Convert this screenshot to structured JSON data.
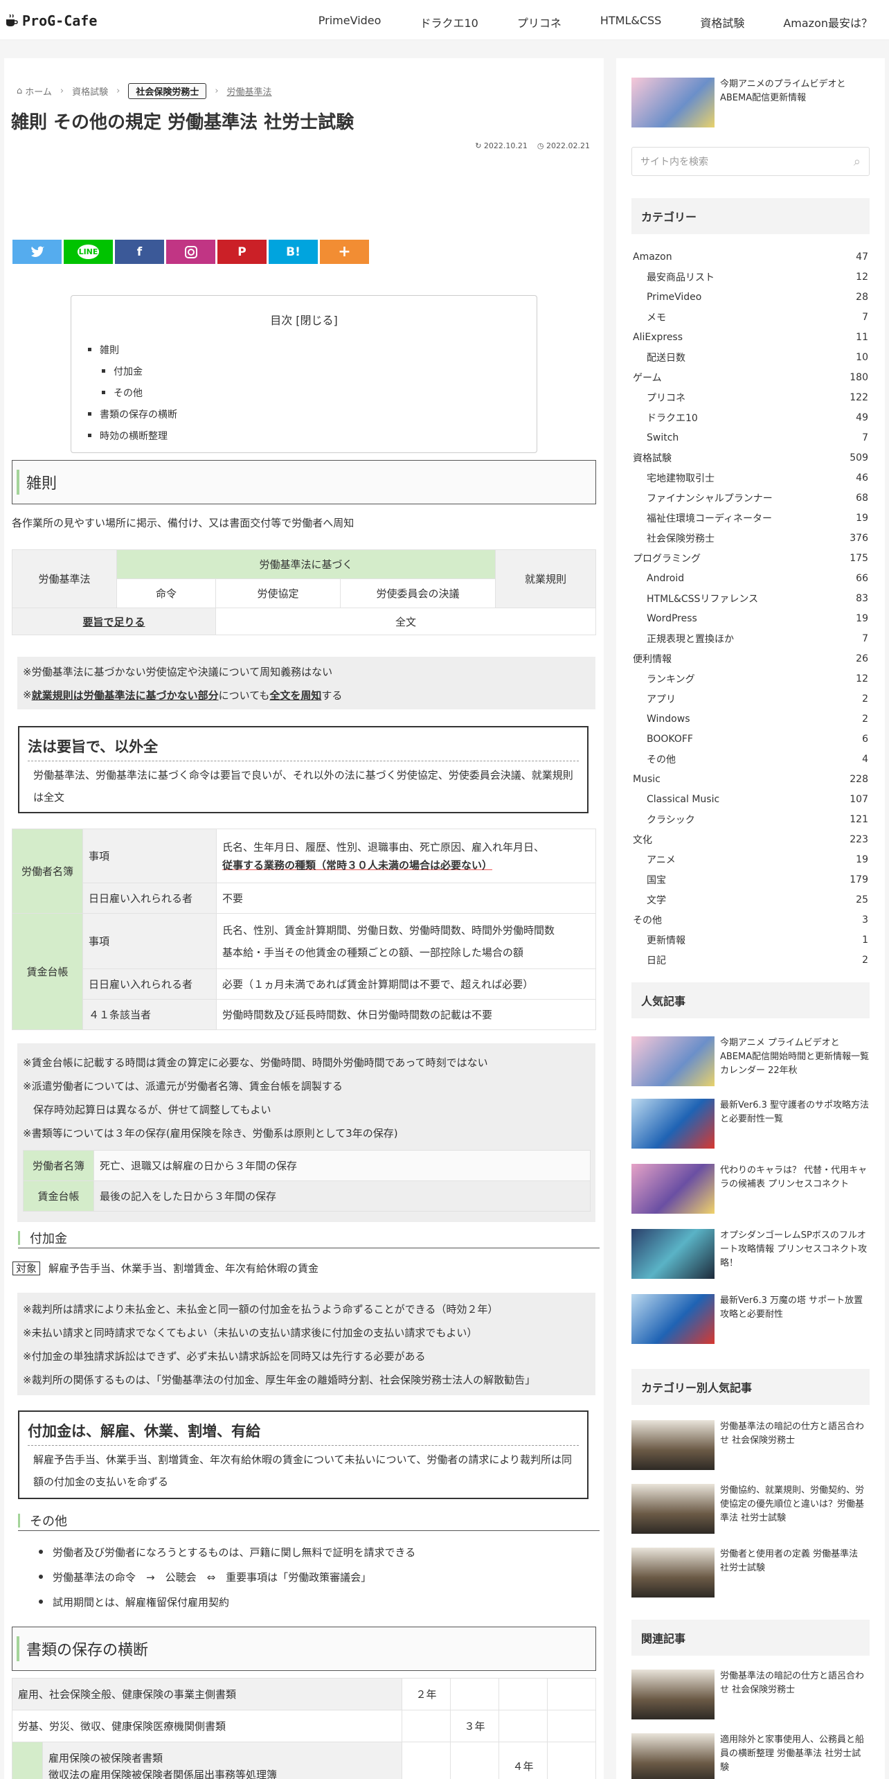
{
  "header": {
    "logo": "ProG-Cafe",
    "nav": [
      "PrimeVideo",
      "ドラクエ10",
      "プリコネ",
      "HTML&CSS",
      "資格試験",
      "Amazon最安は？"
    ]
  },
  "breadcrumb": {
    "home": "ホーム",
    "cat": "資格試験",
    "current": "社会保険労務士",
    "last": "労働基準法"
  },
  "article": {
    "title": "雑則 その他の規定 労働基準法 社労士試験",
    "updated": "2022.10.21",
    "published": "2022.02.21",
    "share": [
      "twitter",
      "LINE",
      "f",
      "instagram",
      "P",
      "B!",
      "+"
    ],
    "toc": {
      "title": "目次",
      "toggle": "[閉じる]",
      "items": [
        "雑則",
        "付加金",
        "その他",
        "書類の保存の横断",
        "時効の横断整理"
      ]
    },
    "s1": {
      "heading": "雑則",
      "intro": "各作業所の見やすい場所に掲示、備付け、又は書面交付等で労働者へ周知",
      "t1": {
        "row_head": "労働基準法",
        "based": "労働基準法に基づく",
        "employment": "就業規則",
        "c1": "命令",
        "c2": "労使協定",
        "c3": "労使委員会の決議",
        "summary": "要旨で足りる",
        "full": "全文"
      },
      "note1": [
        "※労働基準法に基づかない労使協定や決議について周知義務はない"
      ],
      "note1b": {
        "a": "※",
        "b": "就業規則は労働基準法に基づかない部分",
        "c": "についても",
        "d": "全文を周知",
        "e": "する"
      },
      "box1": {
        "title": "法は要旨で、以外全",
        "body": "労働基準法、労働基準法に基づく命令は要旨で良いが、それ以外の法に基づく労使協定、労使委員会決議、就業規則は全文"
      },
      "t2": {
        "roster": "労働者名簿",
        "wage": "賃金台帳",
        "item": "事項",
        "day": "日日雇い入れられる者",
        "art41": "４１条該当者",
        "roster_item_1": "氏名、生年月日、履歴、性別、退職事由、死亡原因、雇入れ年月日、",
        "roster_item_2": "従事する業務の種類（常時３０人未満の場合は必要ない）",
        "roster_day": "不要",
        "wage_item_1": "氏名、性別、賃金計算期間、労働日数、労働時間数、時間外労働時間数",
        "wage_item_2": "基本給・手当その他賃金の種類ごとの額、一部控除した場合の額",
        "wage_day": "必要（１ヵ月未満であれば賃金計算期間は不要で、超えれば必要）",
        "wage_41": "労働時間数及び延長時間数、休日労働時間数の記載は不要"
      },
      "note2": [
        "※賃金台帳に記載する時間は賃金の算定に必要な、労働時間、時間外労働時間であって時刻ではない",
        "※派遣労働者については、派遣元が労働者名簿、賃金台帳を調製する",
        "　保存時効起算日は異なるが、併せて調整してもよい",
        "※書類等については３年の保存(雇用保険を除き、労働系は原則として3年の保存)"
      ],
      "keep": [
        {
          "k": "労働者名簿",
          "v": "死亡、退職又は解雇の日から３年間の保存"
        },
        {
          "k": "賃金台帳",
          "v": "最後の記入をした日から３年間の保存"
        }
      ]
    },
    "s2": {
      "heading": "付加金",
      "target_label": "対象",
      "target": "解雇予告手当、休業手当、割増賃金、年次有給休暇の賃金",
      "note": [
        "※裁判所は請求により未払金と、未払金と同一額の付加金を払うよう命ずることができる（時効２年）",
        "※未払い請求と同時請求でなくてもよい（未払いの支払い請求後に付加金の支払い請求でもよい）",
        "※付加金の単独請求訴訟はできず、必ず未払い請求訴訟を同時又は先行する必要がある",
        "※裁判所の関係するものは、「労働基準法の付加金、厚生年金の離婚時分割、社会保険労務士法人の解散勧告」"
      ],
      "box": {
        "title": "付加金は、解雇、休業、割増、有給",
        "body": "解雇予告手当、休業手当、割増賃金、年次有給休暇の賃金について未払いについて、労働者の請求により裁判所は同額の付加金の支払いを命ずる"
      }
    },
    "s3": {
      "heading": "その他",
      "items": [
        "労働者及び労働者になろうとするものは、戸籍に関し無料で証明を請求できる",
        "労働基準法の命令　→　公聴会　⇔　重要事項は「労働政策審議会」",
        "試用期間とは、解雇権留保付雇用契約"
      ]
    },
    "s4": {
      "heading": "書類の保存の横断",
      "rows": [
        {
          "label": "雇用、社会保険全般、健康保険の事業主側書類",
          "y": "２年"
        },
        {
          "label": "労基、労災、徴収、健康保険医療機関側書類",
          "y": "３年"
        },
        {
          "label1": "雇用保険の被保険者書類",
          "label2": "徴収法の雇用保険被保険者関係届出事務等処理簿",
          "y": "４年"
        }
      ]
    }
  },
  "sidebar": {
    "top_post": "今期アニメのプライムビデオとABEMA配信更新情報",
    "search_placeholder": "サイト内を検索",
    "cat_title": "カテゴリー",
    "categories": [
      [
        "Amazon",
        "47",
        0
      ],
      [
        "最安商品リスト",
        "12",
        1
      ],
      [
        "PrimeVideo",
        "28",
        1
      ],
      [
        "メモ",
        "7",
        1
      ],
      [
        "AliExpress",
        "11",
        0
      ],
      [
        "配送日数",
        "10",
        1
      ],
      [
        "ゲーム",
        "180",
        0
      ],
      [
        "プリコネ",
        "122",
        1
      ],
      [
        "ドラクエ10",
        "49",
        1
      ],
      [
        "Switch",
        "7",
        1
      ],
      [
        "資格試験",
        "509",
        0
      ],
      [
        "宅地建物取引士",
        "46",
        1
      ],
      [
        "ファイナンシャルプランナー",
        "68",
        1
      ],
      [
        "福祉住環境コーディネーター",
        "19",
        1
      ],
      [
        "社会保険労務士",
        "376",
        1
      ],
      [
        "プログラミング",
        "175",
        0
      ],
      [
        "Android",
        "66",
        1
      ],
      [
        "HTML&CSSリファレンス",
        "83",
        1
      ],
      [
        "WordPress",
        "19",
        1
      ],
      [
        "正規表現と置換ほか",
        "7",
        1
      ],
      [
        "便利情報",
        "26",
        0
      ],
      [
        "ランキング",
        "12",
        1
      ],
      [
        "アプリ",
        "2",
        1
      ],
      [
        "Windows",
        "2",
        1
      ],
      [
        "BOOKOFF",
        "6",
        1
      ],
      [
        "その他",
        "4",
        1
      ],
      [
        "Music",
        "228",
        0
      ],
      [
        "Classical Music",
        "107",
        1
      ],
      [
        "クラシック",
        "121",
        1
      ],
      [
        "文化",
        "223",
        0
      ],
      [
        "アニメ",
        "19",
        1
      ],
      [
        "国宝",
        "179",
        1
      ],
      [
        "文学",
        "25",
        1
      ],
      [
        "その他",
        "3",
        0
      ],
      [
        "更新情報",
        "1",
        1
      ],
      [
        "日記",
        "2",
        1
      ]
    ],
    "popular_title": "人気記事",
    "popular": [
      "今期アニメ プライムビデオとABEMA配信開始時間と更新情報一覧カレンダー 22年秋",
      "最新Ver6.3 聖守護者のサポ攻略方法と必要耐性一覧",
      "代わりのキャラは？ 代替・代用キャラの候補表 プリンセスコネクト",
      "オプシダンゴーレムSPボスのフルオート攻略情報 プリンセスコネクト攻略！",
      "最新Ver6.3 万魔の塔 サポート放置攻略と必要耐性"
    ],
    "catpop_title": "カテゴリー別人気記事",
    "catpop": [
      "労働基準法の暗記の仕方と語呂合わせ 社会保険労務士",
      "労働協約、就業規則、労働契約、労使協定の優先順位と違いは？労働基準法 社労士試験",
      "労働者と使用者の定義 労働基準法 社労士試験"
    ],
    "related_title": "関連記事",
    "related": [
      "労働基準法の暗記の仕方と語呂合わせ 社会保険労務士",
      "適用除外と家事使用人、公務員と船員の横断整理 労働基準法 社労士試験"
    ]
  }
}
